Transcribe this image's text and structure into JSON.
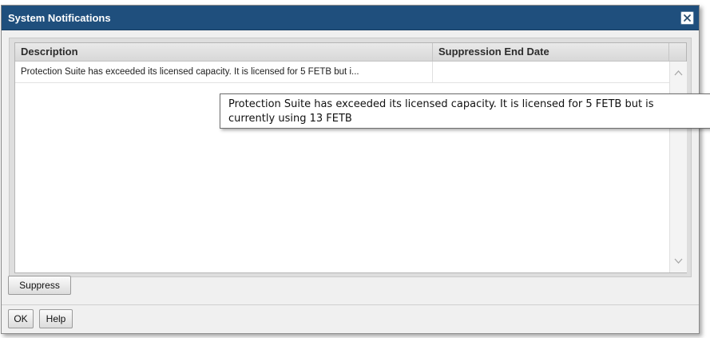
{
  "dialog": {
    "title": "System Notifications",
    "close_icon": "close-icon"
  },
  "table": {
    "columns": [
      "Description",
      "Suppression End Date"
    ],
    "rows": [
      {
        "description": "Protection Suite has exceeded its licensed capacity. It is licensed for 5 FETB but i...",
        "suppression_end_date": ""
      }
    ]
  },
  "tooltip": {
    "text": "Protection Suite has exceeded its licensed capacity. It is licensed for 5 FETB but is currently using 13 FETB"
  },
  "buttons": {
    "suppress": "Suppress",
    "ok": "OK",
    "help": "Help"
  },
  "colors": {
    "titlebar": "#1f4f7d",
    "dialog_bg": "#f0f0f0"
  }
}
